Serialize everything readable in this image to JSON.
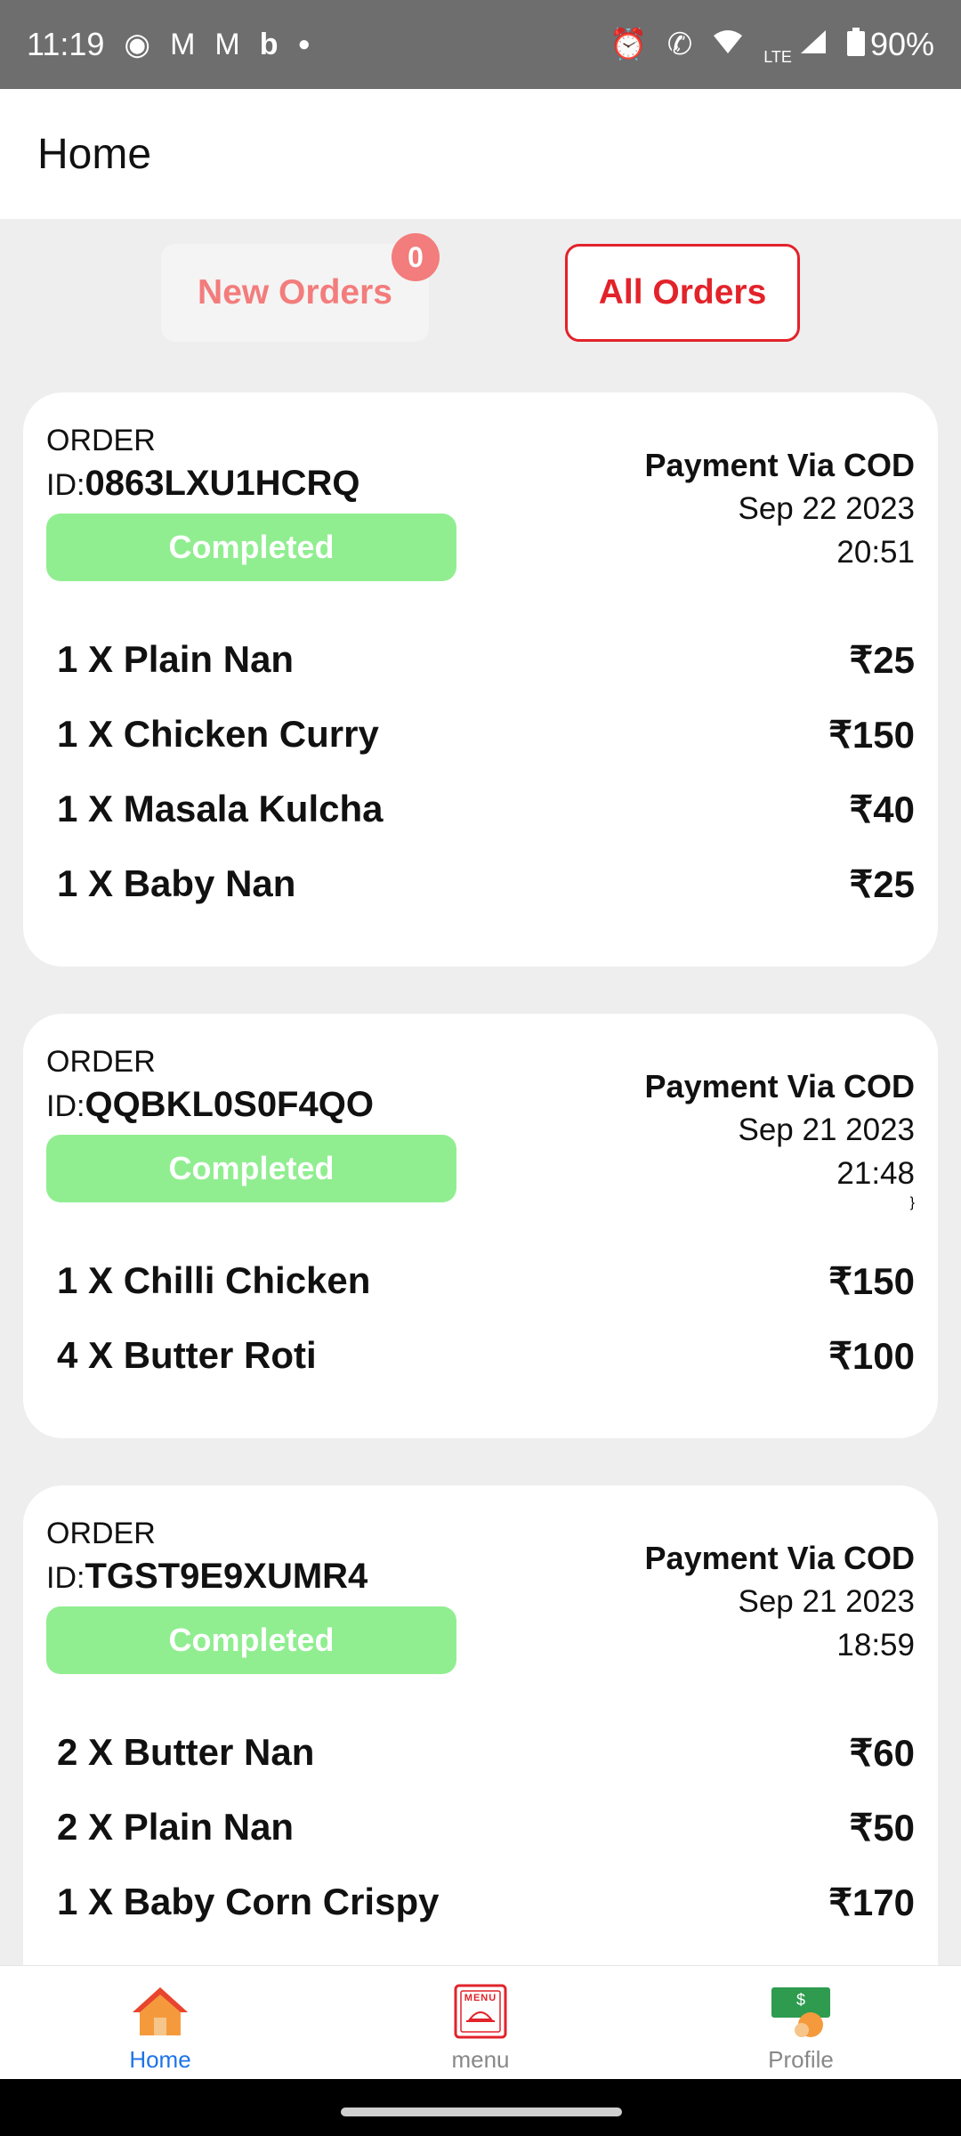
{
  "status_bar": {
    "time": "11:19",
    "battery": "90%",
    "network": "LTE",
    "icons": [
      "location-icon",
      "gmail-icon",
      "gmail-icon",
      "bing-icon",
      "dot-icon",
      "alarm-icon",
      "wifi-call-icon",
      "wifi-icon",
      "signal-icon",
      "battery-icon"
    ]
  },
  "header": {
    "title": "Home"
  },
  "tabs": {
    "new_orders": "New Orders",
    "new_orders_badge": "0",
    "all_orders": "All Orders",
    "active": "all_orders"
  },
  "orders": [
    {
      "label": "ORDER",
      "id_prefix": "ID:",
      "id": "0863LXU1HCRQ",
      "status": "Completed",
      "payment": "Payment Via COD",
      "date": "Sep 22 2023",
      "time": "20:51",
      "items": [
        {
          "name": "1 X Plain Nan",
          "price": "₹25"
        },
        {
          "name": "1 X Chicken Curry",
          "price": "₹150"
        },
        {
          "name": "1 X Masala Kulcha",
          "price": "₹40"
        },
        {
          "name": "1 X Baby Nan",
          "price": "₹25"
        }
      ]
    },
    {
      "label": "ORDER",
      "id_prefix": "ID:",
      "id": "QQBKL0S0F4QO",
      "status": "Completed",
      "payment": "Payment Via COD",
      "date": "Sep 21 2023",
      "time": "21:48",
      "items": [
        {
          "name": "1 X Chilli Chicken",
          "price": "₹150"
        },
        {
          "name": "4 X Butter Roti",
          "price": "₹100"
        }
      ]
    },
    {
      "label": "ORDER",
      "id_prefix": "ID:",
      "id": "TGST9E9XUMR4",
      "status": "Completed",
      "payment": "Payment Via COD",
      "date": "Sep 21 2023",
      "time": "18:59",
      "items": [
        {
          "name": "2 X Butter Nan",
          "price": "₹60"
        },
        {
          "name": "2 X Plain Nan",
          "price": "₹50"
        },
        {
          "name": "1 X Baby Corn Crispy",
          "price": "₹170"
        }
      ]
    }
  ],
  "bottom_nav": {
    "home": "Home",
    "menu": "menu",
    "menu_icon_text": "MENU",
    "profile": "Profile",
    "profile_icon_text": "$"
  },
  "colors": {
    "accent": "#e2232a",
    "badge": "#f37c7c",
    "completed": "#90ee90",
    "nav_active": "#1e73e8"
  }
}
